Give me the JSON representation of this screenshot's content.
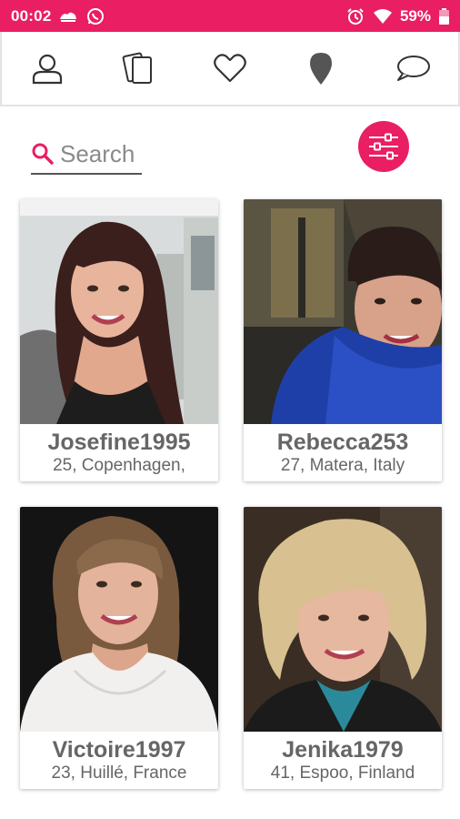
{
  "status_bar": {
    "time": "00:02",
    "battery": "59%",
    "left_icons": [
      "weather-app-icon",
      "whatsapp-icon"
    ],
    "right_icons": [
      "alarm-icon",
      "wifi-icon",
      "battery-icon"
    ],
    "color": "#e91e63"
  },
  "nav": {
    "items": [
      {
        "icon": "profile-icon"
      },
      {
        "icon": "cards-icon"
      },
      {
        "icon": "heart-icon"
      },
      {
        "icon": "location-pin-icon"
      },
      {
        "icon": "chat-icon"
      }
    ]
  },
  "search": {
    "placeholder": "Search",
    "value": ""
  },
  "filter": {
    "icon": "filter-sliders-icon",
    "color": "#e91e63"
  },
  "profiles": [
    {
      "name": "Josefine1995",
      "details": "25, Copenhagen,"
    },
    {
      "name": "Rebecca253",
      "details": "27, Matera, Italy"
    },
    {
      "name": "Victoire1997",
      "details": "23, Huillé, France"
    },
    {
      "name": "Jenika1979",
      "details": "41, Espoo, Finland"
    }
  ]
}
